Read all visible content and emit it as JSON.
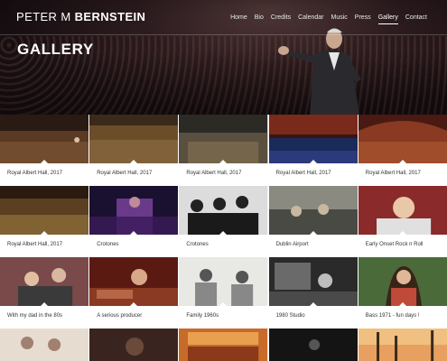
{
  "site": {
    "brand_first": "PETER M ",
    "brand_last": "BERNSTEIN"
  },
  "nav": [
    "Home",
    "Bio",
    "Credits",
    "Calendar",
    "Music",
    "Press",
    "Gallery",
    "Contact"
  ],
  "page_title": "GALLERY",
  "gallery": [
    {
      "caption": "Royal Albert Hall, 2017"
    },
    {
      "caption": "Royal Albert Hall, 2017"
    },
    {
      "caption": "Royal Albert Hall, 2017"
    },
    {
      "caption": "Royal Albert Hall, 2017"
    },
    {
      "caption": "Royal Albert Hall, 2017"
    },
    {
      "caption": "Royal Albert Hall, 2017"
    },
    {
      "caption": "Crotones"
    },
    {
      "caption": "Crotones"
    },
    {
      "caption": "Dublin Airport"
    },
    {
      "caption": "Early Onset Rock n Roll"
    },
    {
      "caption": "With my dad in the 80s"
    },
    {
      "caption": "A serious producer"
    },
    {
      "caption": "Family 1960s"
    },
    {
      "caption": "1980 Studio"
    },
    {
      "caption": "Bass 1971 - fun days !"
    }
  ]
}
